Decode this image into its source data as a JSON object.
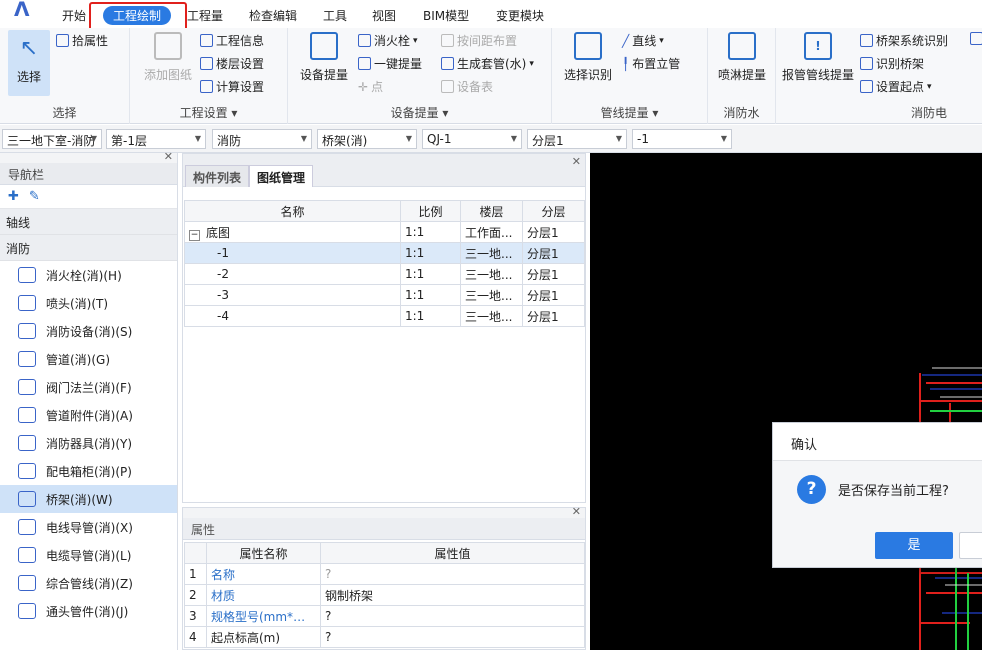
{
  "menu": {
    "tabs": [
      "开始",
      "工程绘制",
      "工程量",
      "检查编辑",
      "工具",
      "视图",
      "BIM模型",
      "变更模块"
    ],
    "active": "工程绘制"
  },
  "ribbon": {
    "select": {
      "big": "选择",
      "pick": "拾属性",
      "group": "选择"
    },
    "project": {
      "add": "添加图纸",
      "info": "工程信息",
      "floor": "楼层设置",
      "calc": "计算设置",
      "group": "工程设置"
    },
    "equipment": {
      "big": "设备提量",
      "hydrant": "消火栓",
      "onekey": "一键提量",
      "point": "点",
      "spacing": "按间距布置",
      "sleeve": "生成套管(水)",
      "table": "设备表",
      "group": "设备提量"
    },
    "pipeline": {
      "big": "选择识别",
      "line": "直线",
      "riser": "布置立管",
      "group": "管线提量"
    },
    "fire_water": {
      "big": "喷淋提量",
      "group": "消防水"
    },
    "fire_elec": {
      "big": "报管管线提量",
      "tray_sys": "桥架系统识别",
      "tray_id": "识别桥架",
      "start": "设置起点",
      "group": "消防电"
    }
  },
  "filters": [
    "三一地下室-消防",
    "第-1层",
    "消防",
    "桥架(消)",
    "QJ-1",
    "分层1",
    "-1"
  ],
  "nav": {
    "title": "导航栏",
    "sections": [
      "轴线",
      "消防"
    ],
    "items": [
      "消火栓(消)(H)",
      "喷头(消)(T)",
      "消防设备(消)(S)",
      "管道(消)(G)",
      "阀门法兰(消)(F)",
      "管道附件(消)(A)",
      "消防器具(消)(Y)",
      "配电箱柜(消)(P)",
      "桥架(消)(W)",
      "电线导管(消)(X)",
      "电缆导管(消)(L)",
      "综合管线(消)(Z)",
      "通头管件(消)(J)"
    ],
    "selected_index": 8
  },
  "drawings": {
    "tabs": [
      "构件列表",
      "图纸管理"
    ],
    "columns": [
      "名称",
      "比例",
      "楼层",
      "分层"
    ],
    "rows": [
      {
        "name": "底图",
        "scale": "1:1",
        "floor": "工作面...",
        "layer": "分层1"
      },
      {
        "name": "-1",
        "scale": "1:1",
        "floor": "三一地...",
        "layer": "分层1"
      },
      {
        "name": "-2",
        "scale": "1:1",
        "floor": "三一地...",
        "layer": "分层1"
      },
      {
        "name": "-3",
        "scale": "1:1",
        "floor": "三一地...",
        "layer": "分层1"
      },
      {
        "name": "-4",
        "scale": "1:1",
        "floor": "三一地...",
        "layer": "分层1"
      }
    ]
  },
  "props": {
    "title": "属性",
    "columns": [
      "属性名称",
      "属性值"
    ],
    "rows": [
      {
        "n": "1",
        "name": "名称",
        "value": "?"
      },
      {
        "n": "2",
        "name": "材质",
        "value": "钢制桥架"
      },
      {
        "n": "3",
        "name": "规格型号(mm*mm)",
        "value": "?"
      },
      {
        "n": "4",
        "name": "起点标高(m)",
        "value": "?"
      }
    ]
  },
  "dialog": {
    "title": "确认",
    "message": "是否保存当前工程?",
    "yes": "是"
  },
  "colors": {
    "accent": "#2a7ae2",
    "highlight": "#e0201c"
  }
}
